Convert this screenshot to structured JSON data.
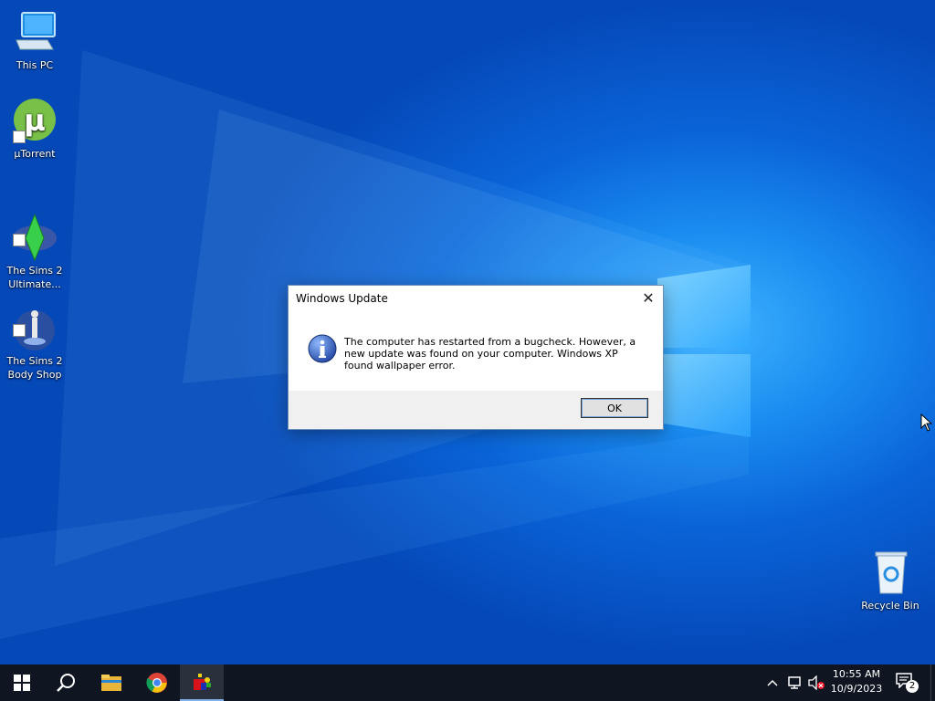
{
  "desktop": {
    "icons": [
      {
        "label": "This PC"
      },
      {
        "label": "µTorrent"
      },
      {
        "label": "The Sims 2\nUltimate..."
      },
      {
        "label": "The Sims 2\nBody Shop"
      },
      {
        "label": "Recycle Bin"
      }
    ]
  },
  "dialog": {
    "title": "Windows Update",
    "message": "The computer has restarted from a bugcheck. However, a new update was found on your computer. Windows XP found wallpaper error.",
    "ok_label": "OK"
  },
  "taskbar": {
    "buttons": [
      "start-icon",
      "search-icon",
      "file-explorer-icon",
      "chrome-icon",
      "app-icon"
    ],
    "clock_time": "10:55 AM",
    "clock_date": "10/9/2023",
    "notification_count": "2"
  },
  "colors": {
    "desktop_blue": "#0a64d8",
    "taskbar": "#101621",
    "accent": "#7fb0e8"
  }
}
